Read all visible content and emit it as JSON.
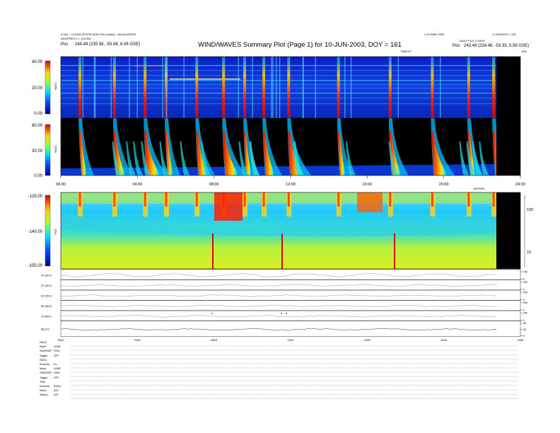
{
  "header": {
    "left_line1": "0.030 = 3 (2003 SPOOR [SSD 000 (Yearly) - ANYA] KEEPS",
    "left_line2": "ANS/PRES.3 = 100.000",
    "left_pos_label": "Pos",
    "left_pos_value": "244.48 (235.58, -53.88, 8.08 GSE)",
    "title": "WIND/WAVES Summary Plot (Page 1) for 10-JUN-2003, DOY = 161",
    "right_line1": "1.10 WED 2003",
    "right_line2": "L1.SOURCE = 501",
    "right_line3": "DAILY FILE 2 DAYS",
    "right_pos_label": "Pos",
    "right_pos_value": "243.49 (234.48, -53.35, 5.59 GSE)",
    "time_label": "TIME/UT",
    "top_right_unit": "kHz"
  },
  "chart_data": [
    {
      "type": "heatmap",
      "panel": "RAD2",
      "colorbar_ticks": [
        "40.00",
        "20.00",
        "0.00"
      ],
      "zlim": [
        0,
        40
      ],
      "burst_times_hours": [
        1.0,
        2.8,
        4.4,
        5.5,
        7.1,
        8.5,
        9.6,
        10.6,
        11.9,
        14.5,
        17.2,
        19.4,
        21.3,
        22.6
      ]
    },
    {
      "type": "heatmap",
      "panel": "RAD1",
      "colorbar_ticks": [
        "60.00",
        "30.00",
        "0.00"
      ],
      "zlim": [
        0,
        60
      ],
      "x_tick_labels": [
        "00:00",
        "04:00",
        "08:00",
        "12:00",
        "16:00",
        "20:00",
        "24:00"
      ],
      "xlim_hours": [
        0,
        24
      ],
      "data_end_hour": 22.8
    },
    {
      "type": "heatmap",
      "panel": "TNR",
      "colorbar_ticks": [
        "-125.00",
        "-140.00",
        "-155.00"
      ],
      "zlim": [
        -155,
        -125
      ],
      "right_axis_ticks": [
        "100",
        "10"
      ],
      "right_axis_scale": "log",
      "corner_label": "DRY0036"
    },
    {
      "type": "line",
      "panel": "housekeeping",
      "labels": [
        "EX (ADC)",
        "EY (ADC)",
        "EZ (ADC)",
        "BX (ADC)",
        "JX (ADC)",
        "|B| (nT)"
      ],
      "right_ticks": [
        [
          "250",
          "0"
        ],
        [
          "250",
          "0"
        ],
        [
          "250",
          "0"
        ],
        [
          "250",
          "0"
        ],
        [
          "250",
          "0"
        ],
        [
          "50",
          "25",
          "0"
        ]
      ],
      "x_tick_labels": [
        "0000",
        "0400",
        "0800",
        "1200",
        "1600",
        "2000",
        "2400"
      ],
      "xlim_hours": [
        0,
        24
      ]
    }
  ],
  "receiver_info": [
    {
      "label": "RAD2",
      "value": ""
    },
    {
      "label": "Mode",
      "value": "LIN/B"
    },
    {
      "label": "SUMS/AP",
      "value": "SUM"
    },
    {
      "label": "Toggle",
      "value": "OFF"
    },
    {
      "label": "RAD1",
      "value": ""
    },
    {
      "label": "Antenna",
      "value": "Ex"
    },
    {
      "label": "Mode",
      "value": "LIN/B"
    },
    {
      "label": "SUMS/AP",
      "value": "SUM"
    },
    {
      "label": "Toggle",
      "value": "OFF"
    },
    {
      "label": "TNR",
      "value": ""
    },
    {
      "label": "Antenna",
      "value": "Ex/Ey"
    },
    {
      "label": "Mode",
      "value": "A/D"
    },
    {
      "label": "Sweep",
      "value": "A/D"
    }
  ]
}
